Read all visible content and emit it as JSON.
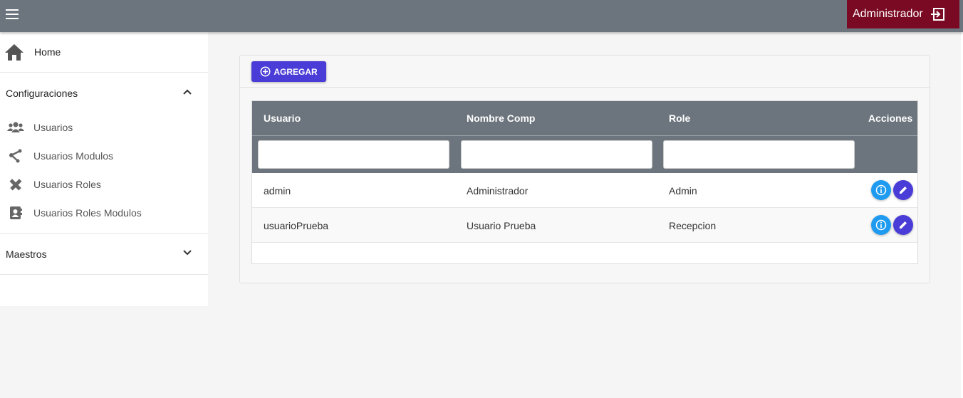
{
  "header": {
    "user_name": "Administrador"
  },
  "sidebar": {
    "home_label": "Home",
    "groups": [
      {
        "label": "Configuraciones",
        "expanded": true,
        "items": [
          {
            "label": "Usuarios",
            "icon": "users-icon"
          },
          {
            "label": "Usuarios Modulos",
            "icon": "share-nodes-icon"
          },
          {
            "label": "Usuarios Roles",
            "icon": "pencil-ruler-icon"
          },
          {
            "label": "Usuarios Roles Modulos",
            "icon": "contact-book-icon"
          }
        ]
      },
      {
        "label": "Maestros",
        "expanded": false,
        "items": []
      }
    ]
  },
  "toolbar": {
    "add_label": "AGREGAR"
  },
  "table": {
    "columns": [
      "Usuario",
      "Nombre Comp",
      "Role",
      "Acciones"
    ],
    "rows": [
      {
        "usuario": "admin",
        "nombre": "Administrador",
        "role": "Admin"
      },
      {
        "usuario": "usuarioPrueba",
        "nombre": "Usuario Prueba",
        "role": "Recepcion"
      }
    ]
  },
  "colors": {
    "topbar": "#6c757d",
    "user_box": "#7a0a23",
    "primary": "#4a3cd6",
    "info": "#1e9bf0"
  }
}
